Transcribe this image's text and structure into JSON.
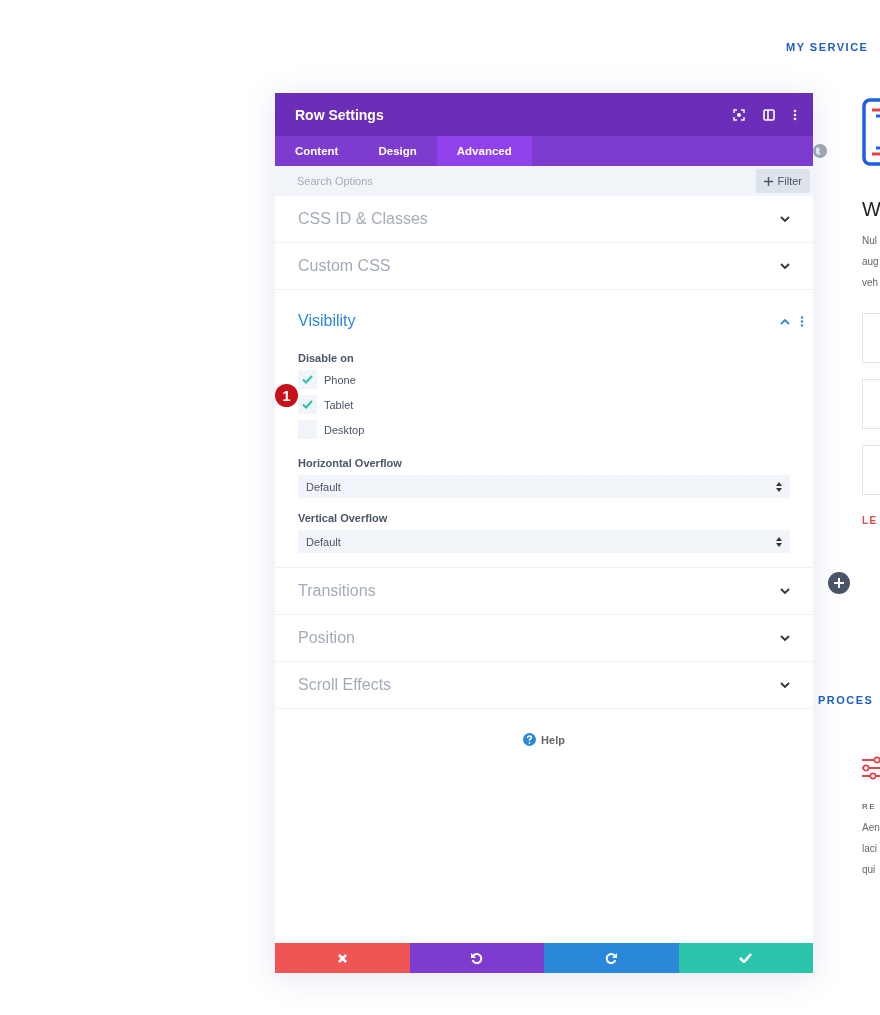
{
  "background": {
    "heading": "MY SERVICE",
    "card_title": "W",
    "card_lines": [
      "Nul",
      "aug",
      "veh"
    ],
    "link": "LE",
    "section_heading": "PROCES",
    "step_title": "RE",
    "step_lines": [
      "Aen",
      "laci",
      "qui"
    ]
  },
  "modal": {
    "title": "Row Settings",
    "tabs": [
      {
        "label": "Content",
        "selected": false
      },
      {
        "label": "Design",
        "selected": false
      },
      {
        "label": "Advanced",
        "selected": true
      }
    ],
    "search": {
      "placeholder": "Search Options"
    },
    "filter": "Filter",
    "sections": [
      {
        "title": "CSS ID & Classes",
        "expanded": false
      },
      {
        "title": "Custom CSS",
        "expanded": false
      },
      {
        "title": "Visibility",
        "expanded": true,
        "disable_label": "Disable on",
        "step_badge": "1",
        "options": [
          {
            "label": "Phone",
            "checked": true
          },
          {
            "label": "Tablet",
            "checked": true
          },
          {
            "label": "Desktop",
            "checked": false
          }
        ],
        "selects": [
          {
            "label": "Horizontal Overflow",
            "value": "Default"
          },
          {
            "label": "Vertical Overflow",
            "value": "Default"
          }
        ]
      },
      {
        "title": "Transitions",
        "expanded": false
      },
      {
        "title": "Position",
        "expanded": false
      },
      {
        "title": "Scroll Effects",
        "expanded": false
      }
    ],
    "help": "Help",
    "footer": [
      {
        "kind": "cancel"
      },
      {
        "kind": "undo"
      },
      {
        "kind": "redo"
      },
      {
        "kind": "save"
      }
    ]
  }
}
